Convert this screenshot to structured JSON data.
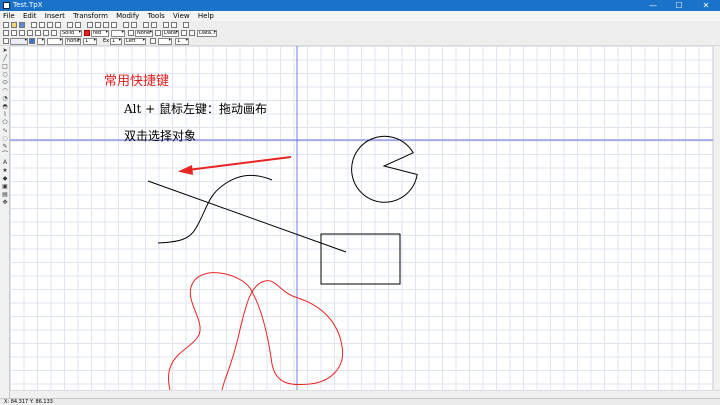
{
  "window": {
    "title": "Test.TpX",
    "minimize": "—",
    "maximize": "☐",
    "close": "✕"
  },
  "menu": [
    "File",
    "Edit",
    "Insert",
    "Transform",
    "Modify",
    "Tools",
    "View",
    "Help"
  ],
  "toolbar2": {
    "line_style": "Solid",
    "line_color": "red",
    "fill": "None",
    "data1": "Data...",
    "data2": "Data..."
  },
  "toolbar3": {
    "arrow_none": "none",
    "width_value": "1",
    "ex_label": "Ex",
    "ex_value": "1",
    "align": "Left",
    "size": "1"
  },
  "canvas_text": {
    "heading": "常用快捷键",
    "line1": "Alt + 鼠标左键：拖动画布",
    "line2": "双击选择对象"
  },
  "colors": {
    "heading": "#e02020",
    "red_path": "#e82424",
    "crosshair": "#6a6ee0",
    "titlebar": "#1a73c8"
  },
  "status": "X: 84.317 Y: 86.133"
}
